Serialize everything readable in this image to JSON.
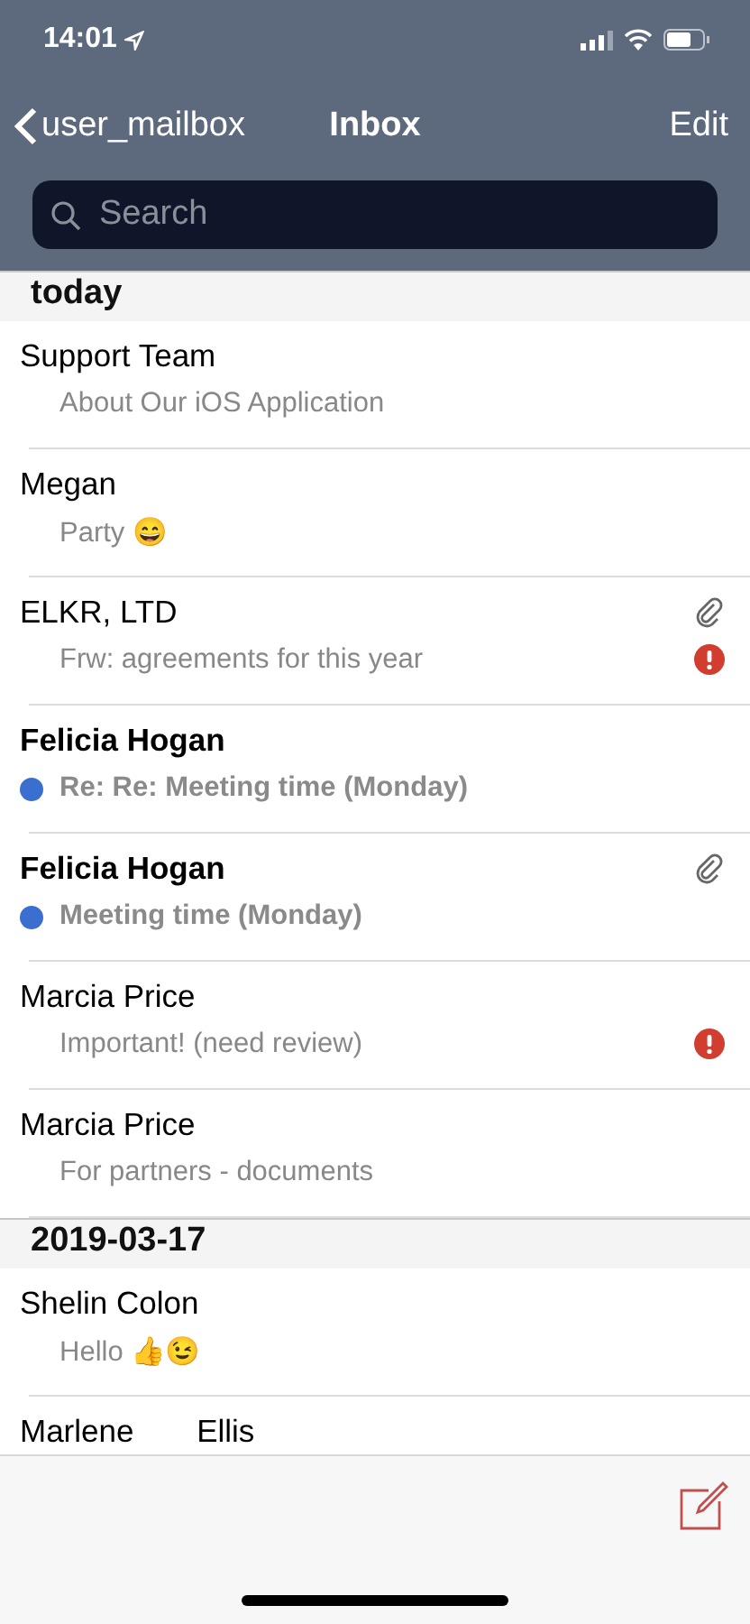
{
  "status_bar": {
    "time": "14:01"
  },
  "nav": {
    "back": "user_mailbox",
    "title": "Inbox",
    "action": "Edit"
  },
  "search": {
    "placeholder": "Search"
  },
  "sections": [
    {
      "title": "today",
      "messages": [
        {
          "sender": "Support Team",
          "subject": "About Our iOS Application",
          "unread": false,
          "attachment": false,
          "important": false
        },
        {
          "sender": "Megan",
          "subject": "Party 😄",
          "unread": false,
          "attachment": false,
          "important": false
        },
        {
          "sender": "ELKR, LTD",
          "subject": "Frw: agreements for this year",
          "unread": false,
          "attachment": true,
          "important": true
        },
        {
          "sender": "Felicia Hogan",
          "subject": "Re: Re: Meeting time (Monday)",
          "unread": true,
          "attachment": false,
          "important": false
        },
        {
          "sender": "Felicia Hogan",
          "subject": "Meeting time (Monday)",
          "unread": true,
          "attachment": true,
          "important": false
        },
        {
          "sender": "Marcia Price",
          "subject": "Important! (need review)",
          "unread": false,
          "attachment": false,
          "important": true
        },
        {
          "sender": "Marcia Price",
          "subject": "For partners - documents",
          "unread": false,
          "attachment": false,
          "important": false
        }
      ]
    },
    {
      "title": "2019-03-17",
      "messages": [
        {
          "sender": "Shelin Colon",
          "subject": "Hello 👍😉",
          "unread": false,
          "attachment": false,
          "important": false
        },
        {
          "sender": "Marlene Ellis",
          "unread": false,
          "attachment": false
        }
      ]
    }
  ]
}
